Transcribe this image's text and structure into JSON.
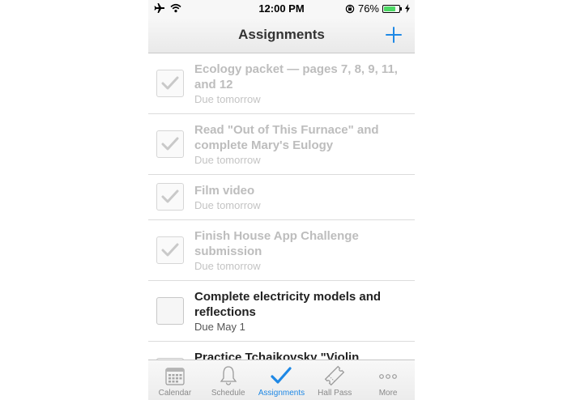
{
  "status_bar": {
    "time": "12:00 PM",
    "battery_percent": "76%",
    "battery_level": 0.76,
    "icons": [
      "airplane-icon",
      "wifi-icon",
      "orientation-lock-icon",
      "battery-icon",
      "charging-icon"
    ]
  },
  "nav": {
    "title": "Assignments",
    "add_icon": "plus-icon"
  },
  "assignments": [
    {
      "title_lines": [
        "Ecology packet — pages 7, 8, 9, 11,",
        "and 12"
      ],
      "due": "Due tomorrow",
      "completed": true
    },
    {
      "title_lines": [
        "Read \"Out of This Furnace\" and",
        "complete Mary's Eulogy"
      ],
      "due": "Due tomorrow",
      "completed": true
    },
    {
      "title_lines": [
        "Film video"
      ],
      "due": "Due tomorrow",
      "completed": true
    },
    {
      "title_lines": [
        "Finish House App Challenge",
        "submission"
      ],
      "due": "Due tomorrow",
      "completed": true
    },
    {
      "title_lines": [
        "Complete electricity models and",
        "reflections"
      ],
      "due": "Due May 1",
      "completed": false
    },
    {
      "title_lines": [
        "Practice Tchaikovsky \"Violin"
      ],
      "due": "",
      "completed": false
    }
  ],
  "tabs": [
    {
      "label": "Calendar",
      "icon": "calendar-icon",
      "active": false
    },
    {
      "label": "Schedule",
      "icon": "bell-icon",
      "active": false
    },
    {
      "label": "Assignments",
      "icon": "checkmark-icon",
      "active": true
    },
    {
      "label": "Hall Pass",
      "icon": "ticket-icon",
      "active": false
    },
    {
      "label": "More",
      "icon": "more-dots-icon",
      "active": false
    }
  ],
  "colors": {
    "accent": "#1e88e5",
    "completed_text": "#bdbdbd",
    "open_text": "#222222",
    "battery_green": "#4cd964"
  }
}
